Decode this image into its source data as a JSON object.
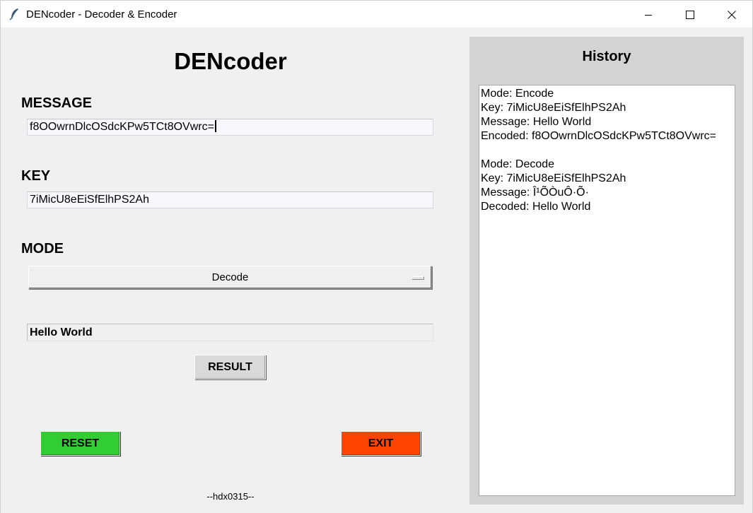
{
  "window": {
    "title": "DENcoder - Decoder & Encoder",
    "app_icon": "feather-icon",
    "controls": [
      "minimize-icon",
      "maximize-icon",
      "close-icon"
    ]
  },
  "main": {
    "heading": "DENcoder",
    "message_label": "MESSAGE",
    "message_value": "f8OOwrnDlcOSdcKPw5TCt8OVwrc=",
    "key_label": "KEY",
    "key_value": "7iMicU8eEiSfElhPS2Ah",
    "mode_label": "MODE",
    "mode_value": "Decode",
    "result_value": "Hello World",
    "result_button": "RESULT",
    "reset_button": "RESET",
    "exit_button": "EXIT",
    "footer": "--hdx0315--"
  },
  "history": {
    "title": "History",
    "lines": [
      "Mode: Encode",
      "Key: 7iMicU8eEiSfElhPS2Ah",
      "Message: Hello World",
      "Encoded: f8OOwrnDlcOSdcKPw5TCt8OVwrc=",
      "",
      "Mode: Decode",
      "Key: 7iMicU8eEiSfElhPS2Ah",
      "Message: Î¹ÕÒuÔ·Õ·",
      "Decoded: Hello World"
    ]
  },
  "colors": {
    "background": "#f0f0f0",
    "history_panel": "#d3d3d3",
    "reset": "#32cd32",
    "exit": "#ff4500",
    "result_button": "#d9d9d9"
  }
}
